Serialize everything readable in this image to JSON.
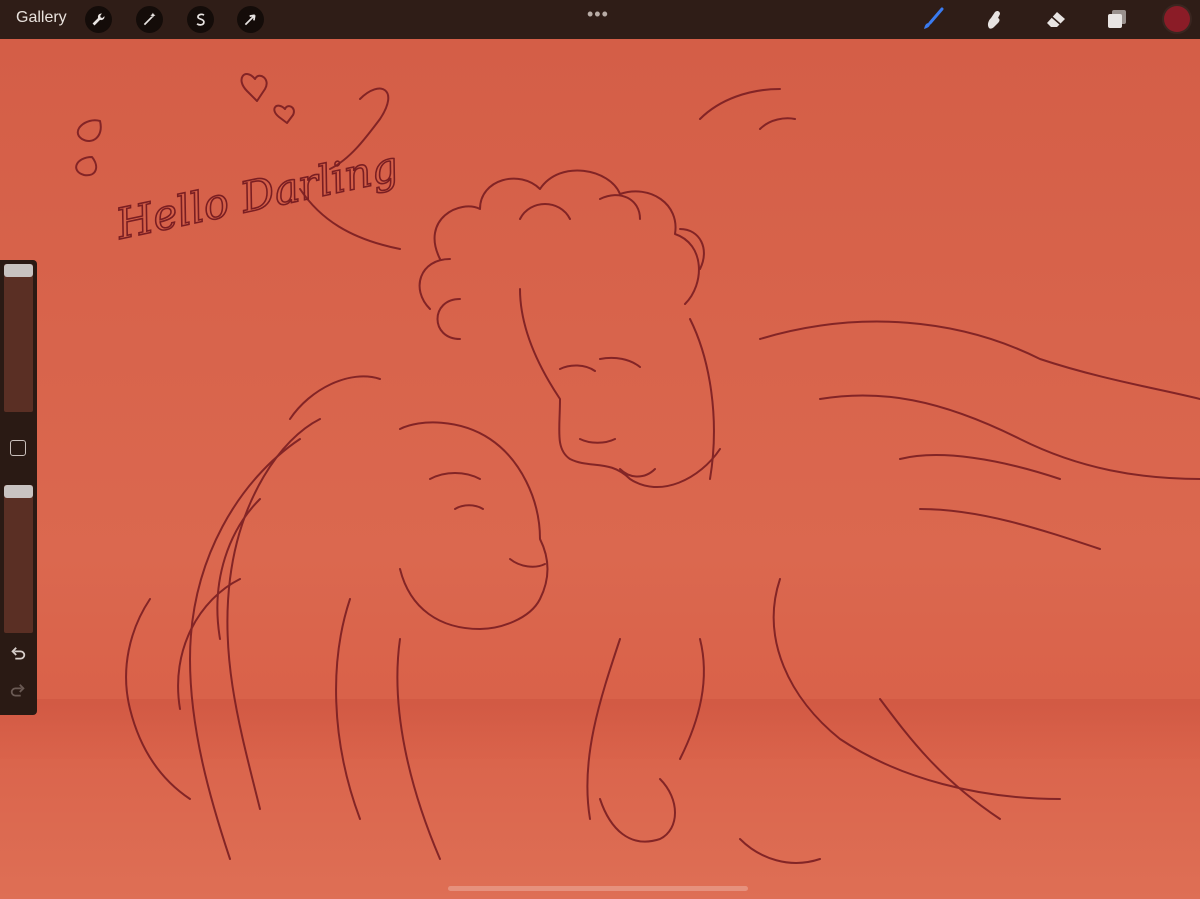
{
  "topbar": {
    "gallery_label": "Gallery",
    "actions": [
      {
        "icon": "wrench-icon"
      },
      {
        "icon": "magic-wand-icon"
      },
      {
        "icon": "selection-s-icon"
      },
      {
        "icon": "transform-arrow-icon"
      }
    ],
    "more_label": "•••",
    "right_tools": [
      {
        "icon": "brush-icon",
        "active": true
      },
      {
        "icon": "smudge-icon",
        "active": false
      },
      {
        "icon": "eraser-icon",
        "active": false
      },
      {
        "icon": "layers-icon",
        "active": false
      }
    ],
    "current_color": "#8b1c27",
    "active_tool_color": "#3a7bf0"
  },
  "canvas": {
    "artwork_text": "Hello Darling",
    "background_color": "#d9654b",
    "line_color": "#7a1e22"
  },
  "sidebar": {
    "brush_size": 0.95,
    "opacity": 0.95,
    "undo_icon": "undo-icon",
    "redo_icon": "redo-icon"
  }
}
